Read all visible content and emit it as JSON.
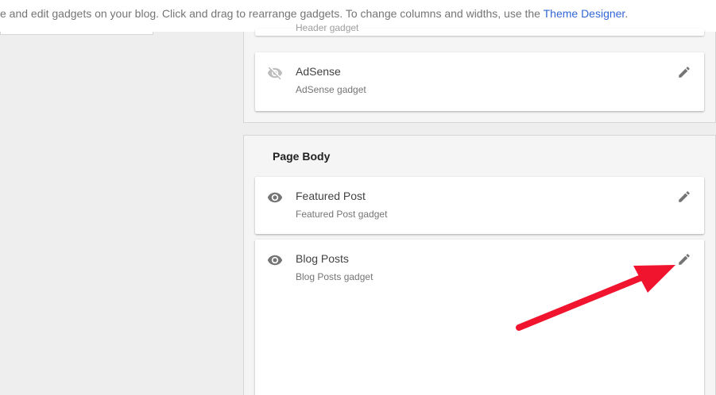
{
  "header": {
    "description": "e and edit gadgets on your blog. Click and drag to rearrange gadgets. To change columns and widths, use the ",
    "link": "Theme Designer",
    "period": "."
  },
  "upper_section": {
    "peek_subtitle": "Header gadget",
    "gadgets": [
      {
        "title": "AdSense",
        "subtitle": "AdSense gadget",
        "visibility_icon": "eye-off-icon",
        "visible": false,
        "edit_icon": "pencil-icon"
      }
    ]
  },
  "page_body": {
    "title": "Page Body",
    "gadgets": [
      {
        "title": "Featured Post",
        "subtitle": "Featured Post gadget",
        "visibility_icon": "eye-icon",
        "visible": true,
        "edit_icon": "pencil-icon"
      },
      {
        "title": "Blog Posts",
        "subtitle": "Blog Posts gadget",
        "visibility_icon": "eye-icon",
        "visible": true,
        "edit_icon": "pencil-icon"
      }
    ]
  },
  "annotation": {
    "type": "red-arrow",
    "color": "#f0142f",
    "points_to": "blog-posts-edit-button"
  },
  "colors": {
    "link": "#3367d6",
    "background": "#eeeeee",
    "card": "#ffffff",
    "icon": "#757575",
    "icon_disabled": "#bdbdbd"
  }
}
